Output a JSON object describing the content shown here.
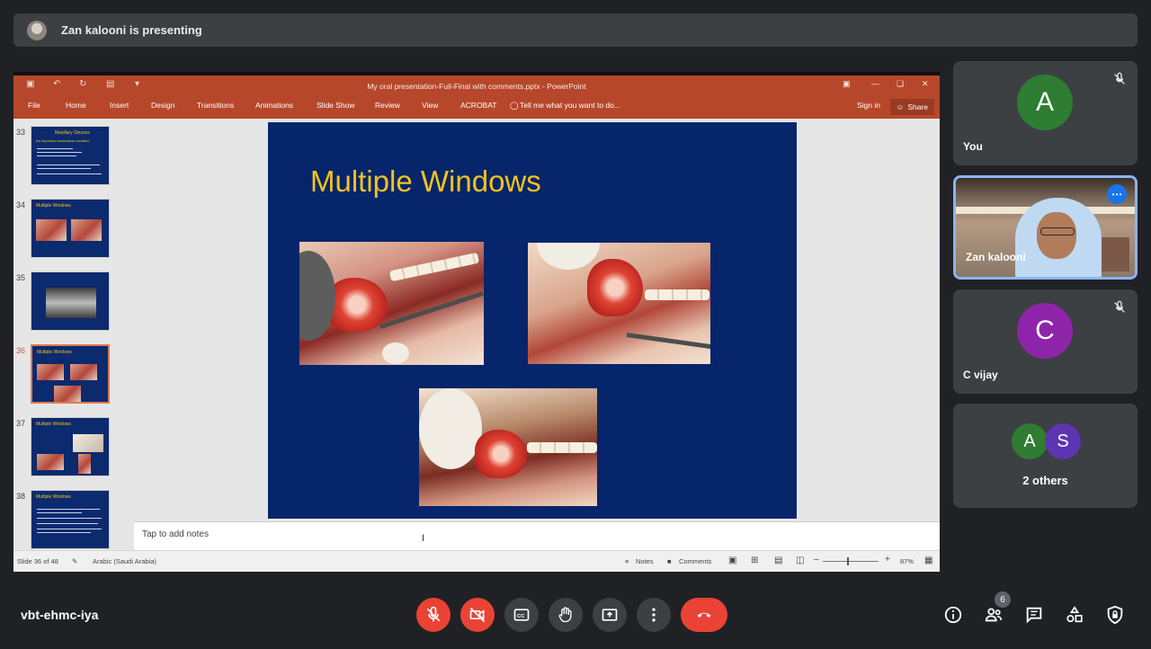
{
  "banner": {
    "text": "Zan kalooni is presenting"
  },
  "powerpoint": {
    "window_title": "My oral presentation-Full-Final with comments.pptx - PowerPoint",
    "tabs": [
      "File",
      "Home",
      "Insert",
      "Design",
      "Transitions",
      "Animations",
      "Slide Show",
      "Review",
      "View",
      "ACROBAT"
    ],
    "tell_me": "Tell me what you want to do...",
    "sign_in": "Sign in",
    "share": "Share",
    "thumbnails": [
      {
        "number": "33",
        "title": "Maxillary Sinuses",
        "subtitle": "An important anatomical variation"
      },
      {
        "number": "34",
        "title": "Multiple Windows"
      },
      {
        "number": "35",
        "title": ""
      },
      {
        "number": "36",
        "title": "Multiple Windows",
        "selected": true
      },
      {
        "number": "37",
        "title": "Multiple Windows"
      },
      {
        "number": "38",
        "title": "Multiple Windows"
      }
    ],
    "slide": {
      "title": "Multiple Windows"
    },
    "notes_placeholder": "Tap to add notes",
    "status": {
      "slide_info": "Slide 36 of 48",
      "language": "Arabic (Saudi Arabia)",
      "notes": "Notes",
      "comments": "Comments",
      "zoom": "87%"
    }
  },
  "participants": [
    {
      "name": "You",
      "initial": "A",
      "color": "#2e7d32",
      "muted": true
    },
    {
      "name": "Zan kalooni",
      "video": true,
      "active": true
    },
    {
      "name": "C vijay",
      "initial": "C",
      "color": "#8e24aa",
      "muted": true
    }
  ],
  "others": {
    "label": "2 others",
    "initials": [
      "A",
      "S"
    ],
    "colors": [
      "#2e7d32",
      "#5e35b1"
    ]
  },
  "meeting": {
    "code": "vbt-ehmc-iya",
    "people_count": "6",
    "colors": {
      "red": "#ea4335",
      "dark": "#3c4043"
    }
  }
}
